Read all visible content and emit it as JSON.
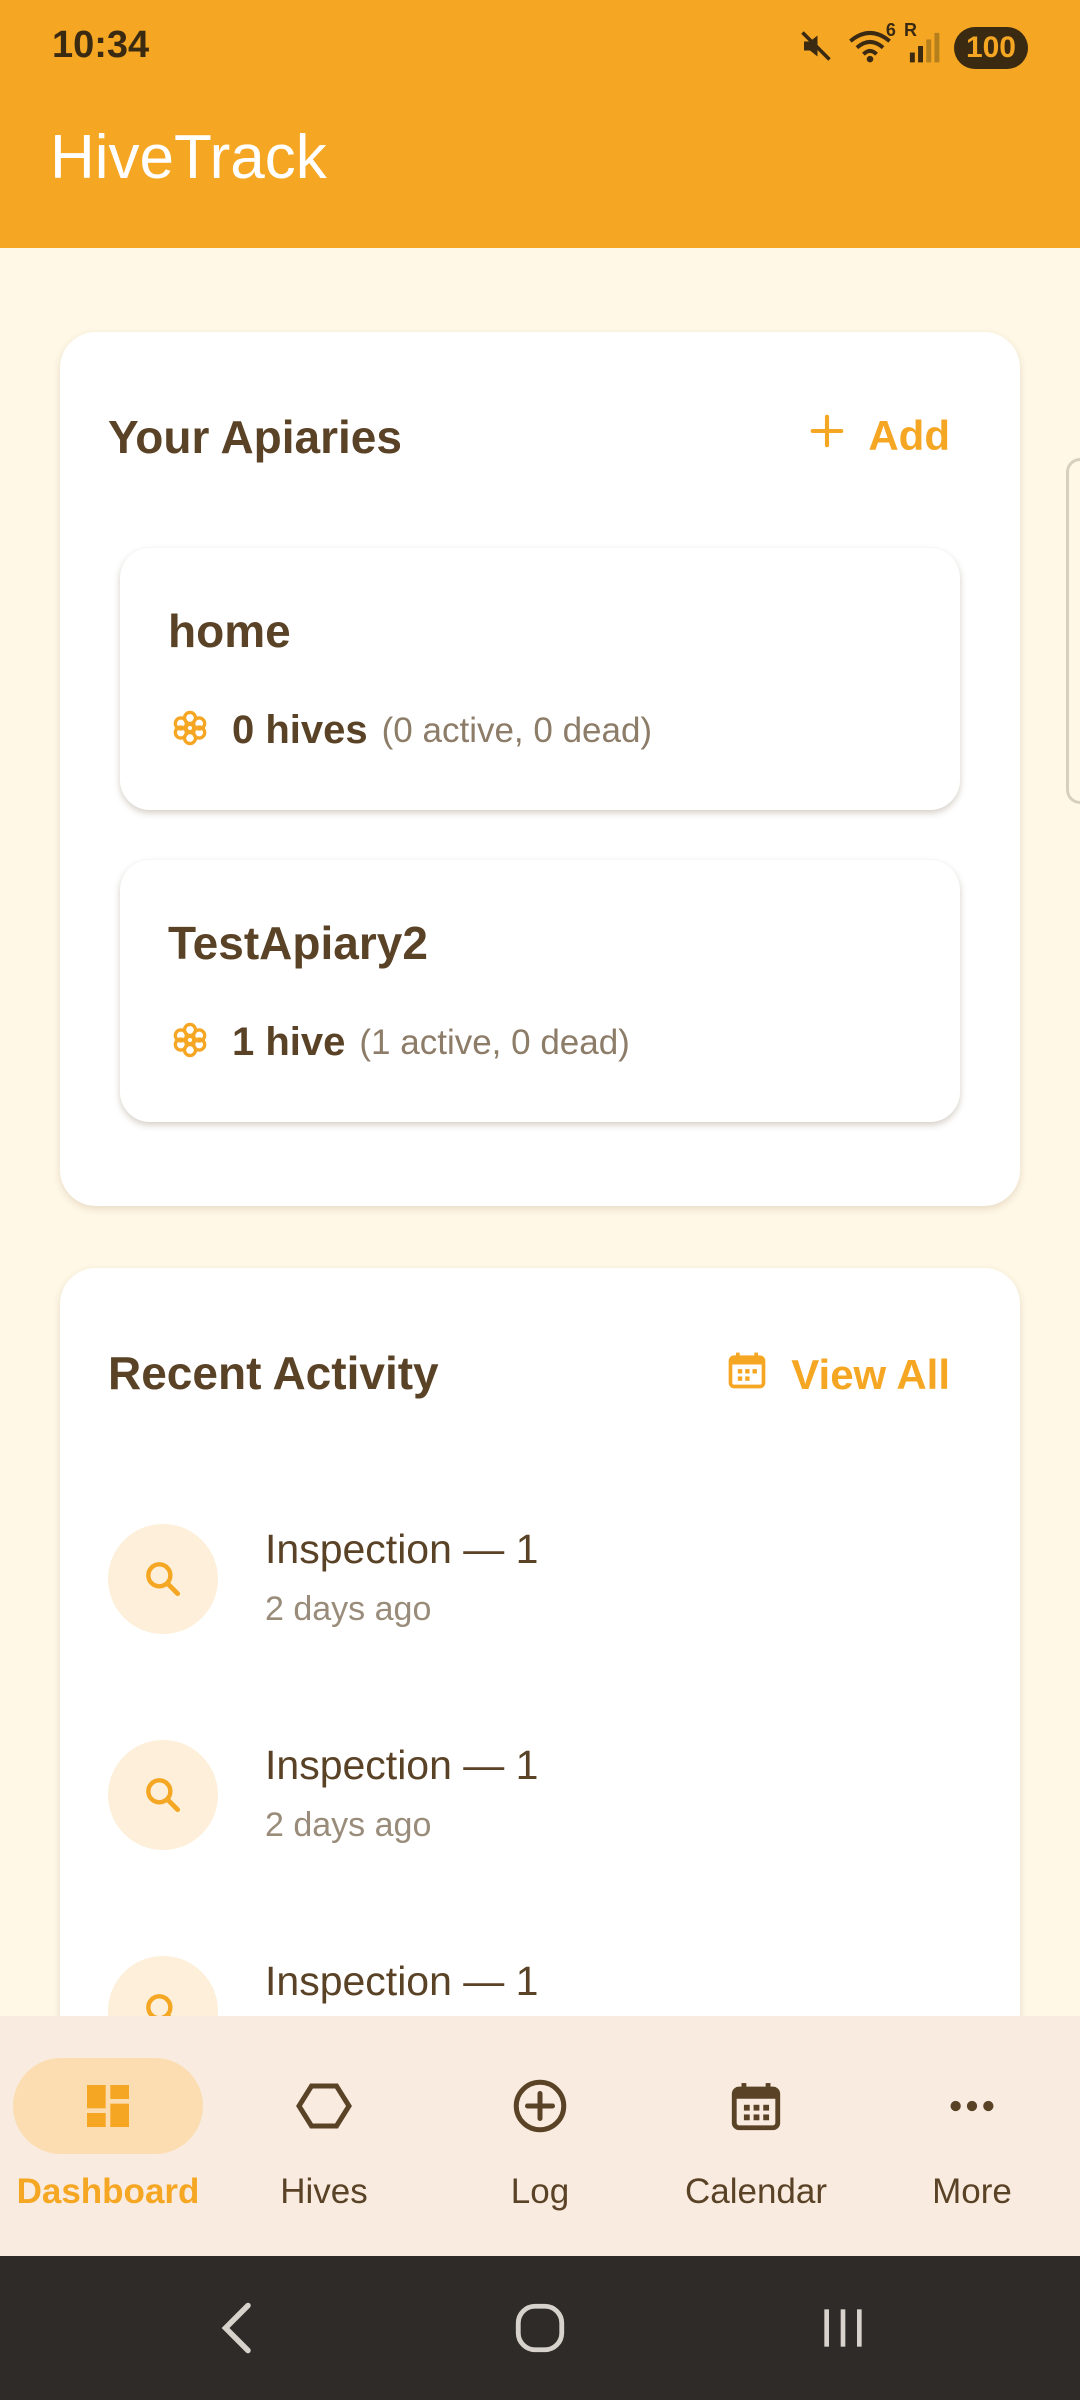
{
  "status_bar": {
    "time": "10:34",
    "battery": "100",
    "signal_label": "R",
    "wifi_label": "6",
    "icons": [
      "mute-icon",
      "wifi-icon",
      "signal-icon",
      "battery-icon"
    ]
  },
  "app": {
    "title": "HiveTrack"
  },
  "apiaries_card": {
    "title": "Your Apiaries",
    "action_label": "Add",
    "action_icon": "plus-icon",
    "items": [
      {
        "name": "home",
        "count": "0 hives",
        "detail": "(0 active, 0 dead)",
        "icon": "hive-icon"
      },
      {
        "name": "TestApiary2",
        "count": "1 hive",
        "detail": "(1 active, 0 dead)",
        "icon": "hive-icon"
      }
    ]
  },
  "activity_card": {
    "title": "Recent Activity",
    "action_label": "View All",
    "action_icon": "calendar-icon",
    "items": [
      {
        "title": "Inspection — 1",
        "time": "2 days ago",
        "icon": "search-icon"
      },
      {
        "title": "Inspection — 1",
        "time": "2 days ago",
        "icon": "search-icon"
      },
      {
        "title": "Inspection — 1",
        "icon": "search-icon"
      }
    ]
  },
  "bottom_nav": {
    "items": [
      {
        "label": "Dashboard",
        "icon": "dashboard-icon",
        "active": true
      },
      {
        "label": "Hives",
        "icon": "hexagon-icon",
        "active": false
      },
      {
        "label": "Log",
        "icon": "add-circle-icon",
        "active": false
      },
      {
        "label": "Calendar",
        "icon": "calendar-icon",
        "active": false
      },
      {
        "label": "More",
        "icon": "more-icon",
        "active": false
      }
    ]
  },
  "colors": {
    "primary": "#F5A623",
    "background": "#FFF8E7",
    "text_dark": "#5A4226",
    "nav_background": "#F9EBDF",
    "system_nav": "#2F2B28"
  }
}
